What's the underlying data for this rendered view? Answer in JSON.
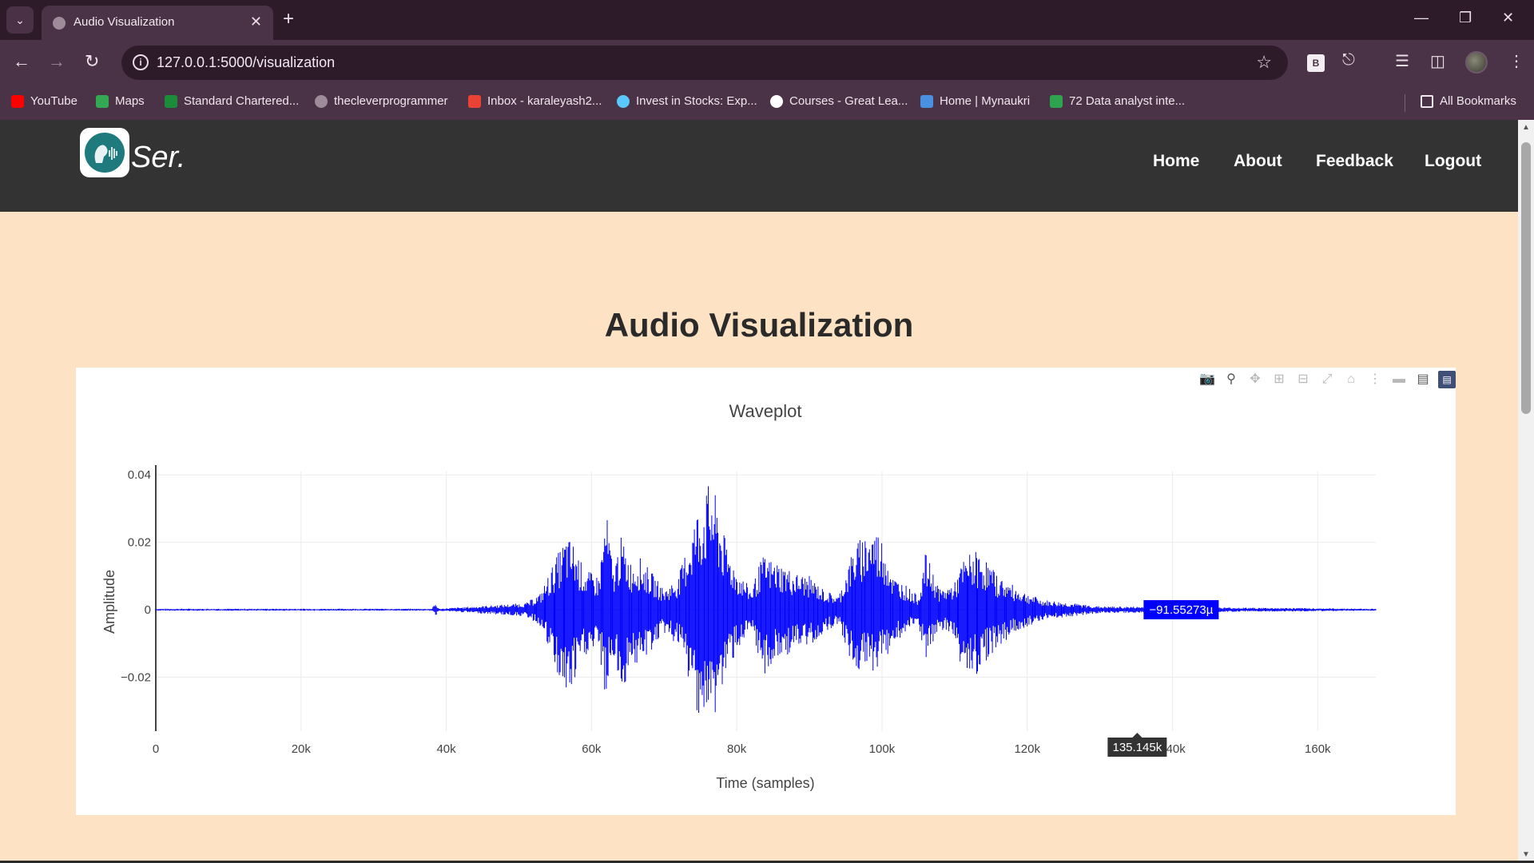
{
  "browser": {
    "tab_title": "Audio Visualization",
    "url": "127.0.0.1:5000/visualization",
    "extension_badge": "B",
    "bookmarks": [
      {
        "label": "YouTube",
        "color": "#FF0000"
      },
      {
        "label": "Maps",
        "color": "#34A853"
      },
      {
        "label": "Standard Chartered...",
        "color": "#1A8C3A"
      },
      {
        "label": "thecleverprogrammer",
        "color": "#CCCCCC"
      },
      {
        "label": "Inbox - karaleyash2...",
        "color": "#EA4335"
      },
      {
        "label": "Invest in Stocks: Exp...",
        "color": "#5AC8FA"
      },
      {
        "label": "Courses - Great Lea...",
        "color": "#FFFFFF"
      },
      {
        "label": "Home | Mynaukri",
        "color": "#4A90E2"
      },
      {
        "label": "72 Data analyst inte...",
        "color": "#2EA44F"
      }
    ],
    "all_bookmarks": "All Bookmarks"
  },
  "site": {
    "logo_text": "Ser.",
    "nav": [
      "Home",
      "About",
      "Feedback",
      "Logout"
    ]
  },
  "page": {
    "title": "Audio Visualization"
  },
  "chart_data": {
    "type": "line",
    "title": "Waveplot",
    "xlabel": "Time (samples)",
    "ylabel": "Amplitude",
    "xlim": [
      0,
      168000
    ],
    "ylim": [
      -0.036,
      0.041
    ],
    "x_ticks": [
      0,
      20000,
      40000,
      60000,
      80000,
      100000,
      120000,
      140000,
      160000
    ],
    "x_tick_labels": [
      "0",
      "20k",
      "40k",
      "60k",
      "80k",
      "100k",
      "120k",
      "140k",
      "160k"
    ],
    "y_ticks": [
      -0.02,
      0,
      0.02,
      0.04
    ],
    "y_tick_labels": [
      "−0.02",
      "0",
      "0.02",
      "0.04"
    ],
    "grid": true,
    "series": [
      {
        "color": "#0000FF",
        "envelope": {
          "x": [
            0,
            38000,
            38500,
            39000,
            51000,
            53000,
            55000,
            56500,
            57500,
            59000,
            61000,
            62000,
            63000,
            64000,
            65500,
            66500,
            68000,
            70000,
            72000,
            74500,
            76500,
            77500,
            78500,
            80000,
            82000,
            83500,
            86000,
            88000,
            90000,
            92000,
            94000,
            96000,
            97500,
            99000,
            100500,
            101500,
            103000,
            105000,
            106000,
            108000,
            110000,
            111000,
            112500,
            114000,
            116000,
            119000,
            122000,
            126000,
            130000,
            168000
          ],
          "upper": [
            0.0003,
            0.0003,
            0.002,
            0.0003,
            0.002,
            0.005,
            0.015,
            0.022,
            0.02,
            0.012,
            0.01,
            0.03,
            0.012,
            0.022,
            0.014,
            0.016,
            0.012,
            0.006,
            0.01,
            0.03,
            0.039,
            0.03,
            0.02,
            0.012,
            0.006,
            0.016,
            0.014,
            0.011,
            0.01,
            0.006,
            0.004,
            0.018,
            0.023,
            0.025,
            0.02,
            0.01,
            0.008,
            0.004,
            0.017,
            0.006,
            0.008,
            0.014,
            0.018,
            0.016,
            0.01,
            0.006,
            0.003,
            0.002,
            0.001,
            0.0003
          ],
          "lower": [
            -0.0003,
            -0.0003,
            -0.002,
            -0.0003,
            -0.002,
            -0.005,
            -0.018,
            -0.027,
            -0.024,
            -0.014,
            -0.012,
            -0.028,
            -0.014,
            -0.027,
            -0.015,
            -0.018,
            -0.013,
            -0.007,
            -0.011,
            -0.03,
            -0.036,
            -0.028,
            -0.02,
            -0.012,
            -0.007,
            -0.02,
            -0.015,
            -0.012,
            -0.011,
            -0.007,
            -0.004,
            -0.018,
            -0.019,
            -0.018,
            -0.015,
            -0.01,
            -0.008,
            -0.004,
            -0.016,
            -0.006,
            -0.008,
            -0.018,
            -0.021,
            -0.016,
            -0.011,
            -0.006,
            -0.003,
            -0.002,
            -0.001,
            -0.0003
          ]
        }
      }
    ],
    "hover": {
      "x": 135145,
      "x_label": "135.145k",
      "y_label": "−91.55273µ"
    },
    "modebar": [
      "camera-icon",
      "zoom-icon",
      "pan-icon",
      "zoom-in-icon",
      "zoom-out-icon",
      "autoscale-icon",
      "reset-axes-icon",
      "spike-lines-icon",
      "hover-closest-icon",
      "hover-compare-icon",
      "plotly-logo-icon"
    ]
  }
}
